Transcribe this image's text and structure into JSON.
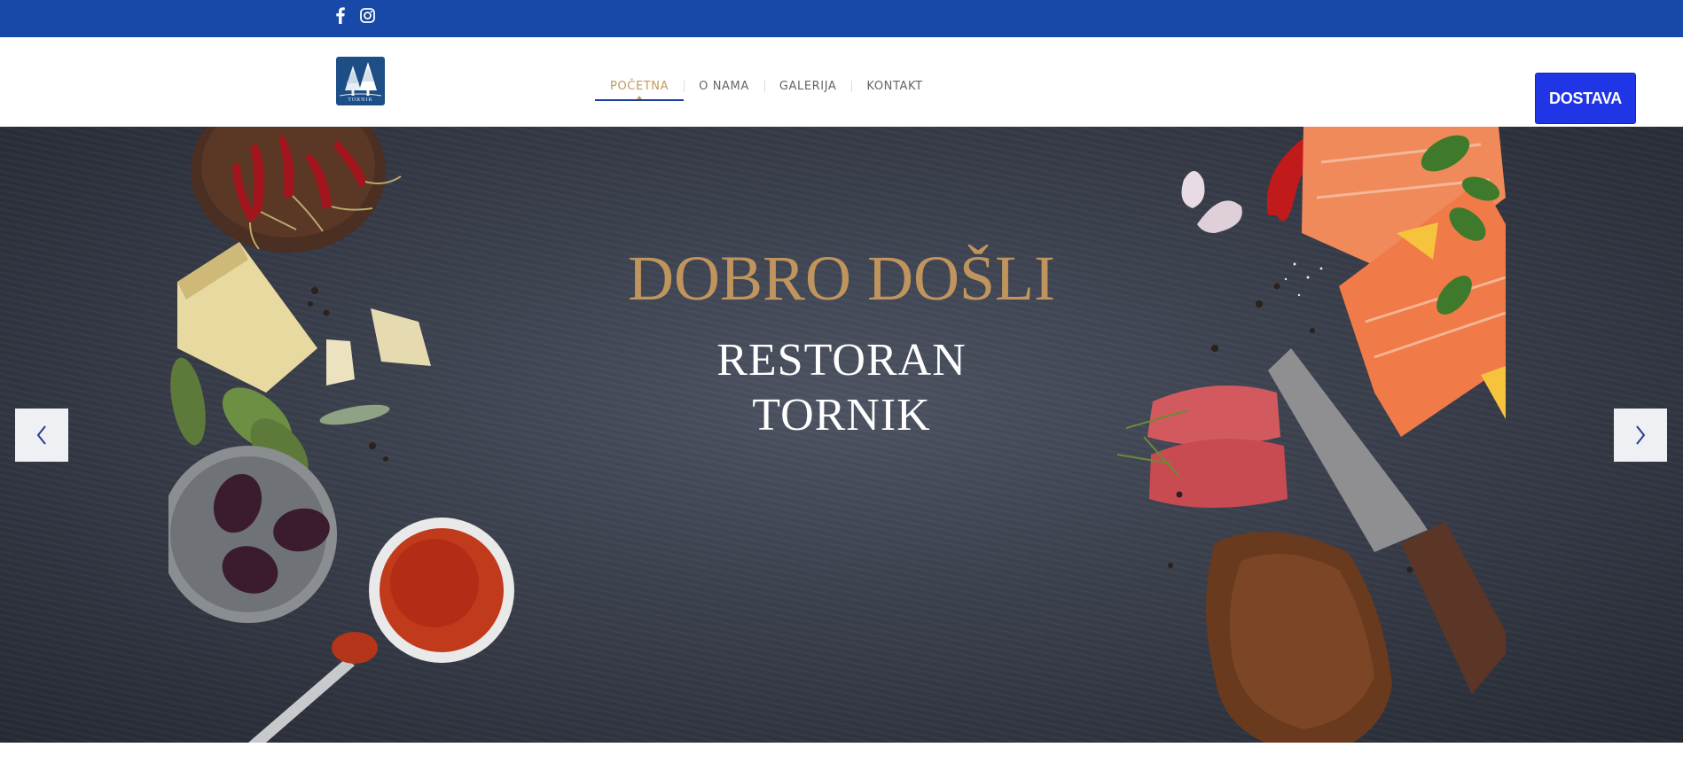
{
  "topbar": {
    "social": [
      {
        "icon": "facebook-icon",
        "glyph": "f"
      },
      {
        "icon": "instagram-icon"
      }
    ]
  },
  "header": {
    "logo_text": "TORNIK",
    "nav": [
      {
        "label": "POČETNA",
        "active": true
      },
      {
        "label": "O NAMA",
        "active": false
      },
      {
        "label": "GALERIJA",
        "active": false
      },
      {
        "label": "KONTAKT",
        "active": false
      }
    ],
    "cta_label": "DOSTAVA"
  },
  "hero": {
    "welcome": "DOBRO DOŠLI",
    "title_line1": "RESTORAN",
    "title_line2": "TORNIK",
    "prev_icon": "chevron-left-icon",
    "next_icon": "chevron-right-icon"
  },
  "colors": {
    "topbar": "#1849a9",
    "accent_gold": "#c29a5b",
    "cta_blue": "#1f35e6",
    "nav_underline": "#1a3f9c"
  }
}
